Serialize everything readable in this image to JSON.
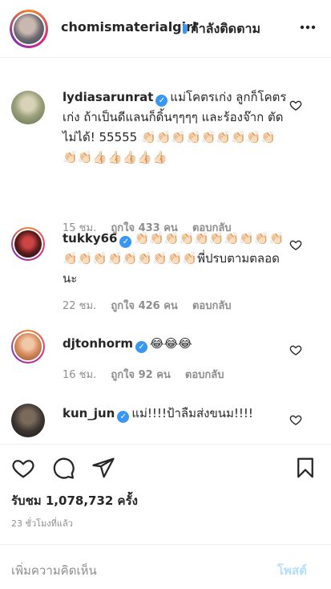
{
  "header": {
    "username": "chomismaterialgirl",
    "separator": "•",
    "follow_status": "กำลังติดตาม",
    "more_icon": "more-horizontal-icon"
  },
  "comments": [
    {
      "username": "lydiasarunrat",
      "verified": true,
      "text": "แม่โคตรเก่ง ลูกก็โคตรเก่ง ถ้าเป็นดีแลนก็ดิ้นๆๆๆๆ และร้องจ๊าก ตัดไม่ได้! 55555 👏🏻👏🏻👏🏻👏🏻👏🏻👏🏻👏🏻👏🏻👏🏻👏🏻👏🏻👍🏻👍🏻👍🏻👍🏻👍🏻",
      "time": "15 ชม.",
      "likes": "ถูกใจ 433 คน",
      "reply": "ตอบกลับ"
    },
    {
      "username": "tukky66",
      "verified": true,
      "text": "👏🏻👏🏻👏🏻👏🏻👏🏻👏🏻👏🏻👏🏻👏🏻👏🏻👏🏻👏🏻👏🏻👏🏻👏🏻👏🏻👏🏻👏🏻👏🏻พี่ปรบตามตลอดนะ",
      "time": "22 ชม.",
      "likes": "ถูกใจ 426 คน",
      "reply": "ตอบกลับ"
    },
    {
      "username": "djtonhorm",
      "verified": true,
      "text": "😂😂😂",
      "time": "16 ชม.",
      "likes": "ถูกใจ 92 คน",
      "reply": "ตอบกลับ"
    },
    {
      "username": "kun_jun",
      "verified": true,
      "text": "แม่!!!!ป้าลืมส่งขนม!!!!",
      "time": "",
      "likes": "",
      "reply": ""
    }
  ],
  "actions": {
    "like_icon": "heart-icon",
    "comment_icon": "comment-icon",
    "share_icon": "send-icon",
    "save_icon": "bookmark-icon",
    "views": "รับชม 1,078,732 ครั้ง",
    "posted_time": "23 ชั่วโมงที่แล้ว"
  },
  "input": {
    "placeholder": "เพิ่มความคิดเห็น",
    "post_label": "โพสต์"
  },
  "colors": {
    "verified": "#3897f0",
    "post_disabled": "#b2dffc",
    "muted": "#8e8e8e"
  }
}
